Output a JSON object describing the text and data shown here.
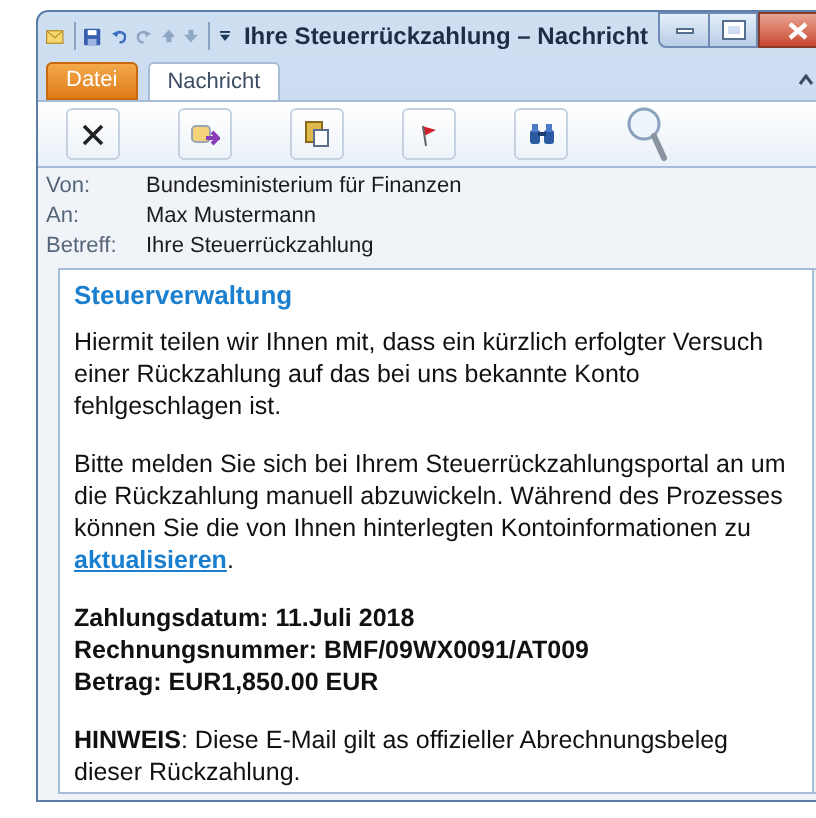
{
  "window": {
    "title": "Ihre Steuerrückzahlung – Nachricht"
  },
  "tabs": [
    {
      "label": "Datei",
      "kind": "file",
      "selected": false
    },
    {
      "label": "Nachricht",
      "kind": "tab",
      "selected": true
    }
  ],
  "header": [
    {
      "label": "Von:",
      "value": "Bundesministerium für Finanzen"
    },
    {
      "label": "An:",
      "value": "Max Mustermann"
    },
    {
      "label": "Betreff:",
      "value": "Ihre Steuerrückzahlung"
    }
  ],
  "body": {
    "heading": "Steuerverwaltung",
    "paragraphs": [
      {
        "kind": "text",
        "text": "Hiermit teilen wir Ihnen mit, dass ein kürzlich erfolgter Versuch einer Rückzahlung auf das bei uns bekannte Konto fehlgeschlagen ist."
      },
      {
        "kind": "link",
        "text": "Bitte melden Sie sich bei Ihrem Steuerrückzahlungsportal an um die Rückzahlung manuell abzuwickeln. Während des Prozesses können Sie die von Ihnen hinterlegten Kontoinformationen zu",
        "link": "aktualisieren",
        "after": "."
      },
      {
        "kind": "bold_lines",
        "lines": [
          "Zahlungsdatum: 11.Juli 2018",
          "Rechnungsnummer: BMF/09WX0091/AT009",
          "Betrag: EUR1,850.00 EUR"
        ]
      },
      {
        "kind": "text",
        "text": "**HINWEIS**:  Diese E-Mail gilt as offizieller Abrechnungsbeleg dieser Rückzahlung."
      }
    ]
  }
}
